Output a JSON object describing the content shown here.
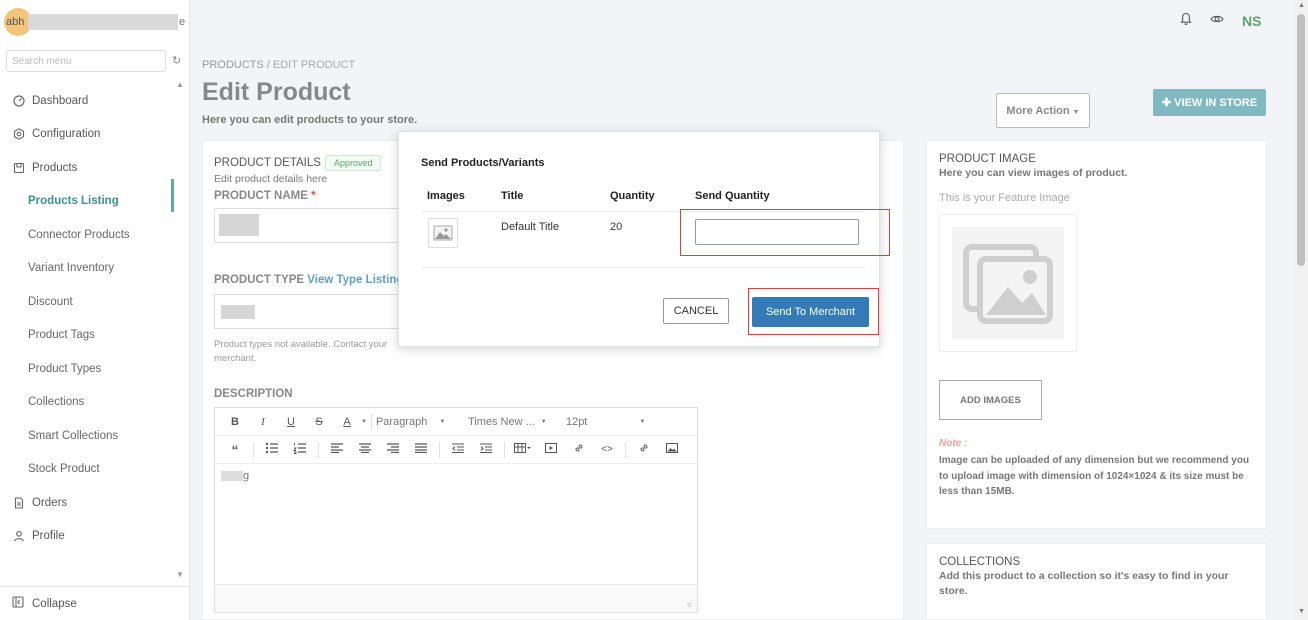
{
  "sidebar": {
    "user_initials": "abh",
    "user_name_tail": "e",
    "search_placeholder": "Search menu",
    "items": [
      {
        "label": "Dashboard"
      },
      {
        "label": "Configuration"
      },
      {
        "label": "Products"
      },
      {
        "label": "Products Listing"
      },
      {
        "label": "Connector Products"
      },
      {
        "label": "Variant Inventory"
      },
      {
        "label": "Discount"
      },
      {
        "label": "Product Tags"
      },
      {
        "label": "Product Types"
      },
      {
        "label": "Collections"
      },
      {
        "label": "Smart Collections"
      },
      {
        "label": "Stock Product"
      },
      {
        "label": "Orders"
      },
      {
        "label": "Profile"
      }
    ],
    "collapse_label": "Collapse"
  },
  "topbar": {
    "initials": "NS"
  },
  "page": {
    "breadcrumb_root": "PRODUCTS",
    "breadcrumb_sep": " / ",
    "breadcrumb_current": "EDIT PRODUCT",
    "title": "Edit Product",
    "subtitle": "Here you can edit products to your store.",
    "more_action": "More Action",
    "view_in_store": "VIEW IN STORE"
  },
  "details": {
    "section_title": "PRODUCT DETAILS",
    "status_badge": "Approved",
    "section_sub": "Edit product details here",
    "name_label": "PRODUCT NAME",
    "required_mark": "*",
    "type_label": "PRODUCT TYPE",
    "type_link": "View Type Listing",
    "type_hint": "Product types not available. Contact your merchant.",
    "desc_label": "DESCRIPTION"
  },
  "editor": {
    "format": "Paragraph",
    "font": "Times New ...",
    "size": "12pt",
    "body_tail": "g"
  },
  "image_panel": {
    "title": "PRODUCT IMAGE",
    "subtitle": "Here you can view images of product.",
    "feature_text": "This is your Feature Image",
    "add_images": "ADD IMAGES",
    "note_label": "Note :",
    "note_text": "Image can be uploaded of any dimension but we recommend you to upload image with dimension of 1024×1024 & its size must be less than 15MB."
  },
  "collections_panel": {
    "title": "COLLECTIONS",
    "subtitle": "Add this product to a collection so it's easy to find in your store."
  },
  "modal": {
    "title": "Send Products/Variants",
    "columns": [
      "Images",
      "Title",
      "Quantity",
      "Send Quantity"
    ],
    "row": {
      "title": "Default Title",
      "quantity": "20",
      "send_quantity": ""
    },
    "cancel": "CANCEL",
    "send": "Send To Merchant"
  },
  "colors": {
    "primary": "#337ab7",
    "accent": "#5fa8ae",
    "highlight": "#e23d3d",
    "success": "#5ba56a"
  }
}
